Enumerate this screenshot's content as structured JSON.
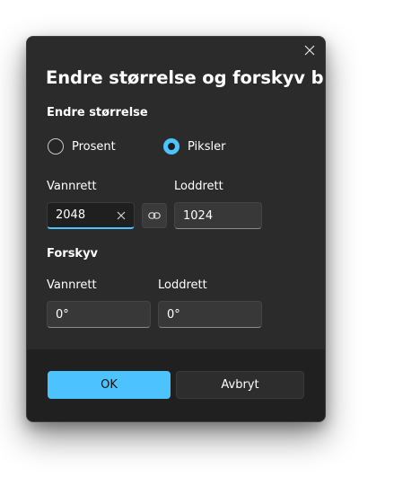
{
  "dialog": {
    "title": "Endre størrelse og forskyv bilde",
    "close_icon": "close-icon"
  },
  "resize": {
    "heading": "Endre størrelse",
    "options": [
      {
        "label": "Prosent",
        "selected": false
      },
      {
        "label": "Piksler",
        "selected": true
      }
    ],
    "horizontal_label": "Vannrett",
    "horizontal_value": "2048",
    "vertical_label": "Loddrett",
    "vertical_value": "1024",
    "clear_icon": "close-icon",
    "link_icon": "link-icon"
  },
  "skew": {
    "heading": "Forskyv",
    "horizontal_label": "Vannrett",
    "horizontal_value": "0°",
    "vertical_label": "Loddrett",
    "vertical_value": "0°"
  },
  "buttons": {
    "ok": "OK",
    "cancel": "Avbryt"
  },
  "colors": {
    "accent": "#4cc2ff",
    "dialog_bg": "#2b2b2b",
    "footer_bg": "#202020"
  }
}
